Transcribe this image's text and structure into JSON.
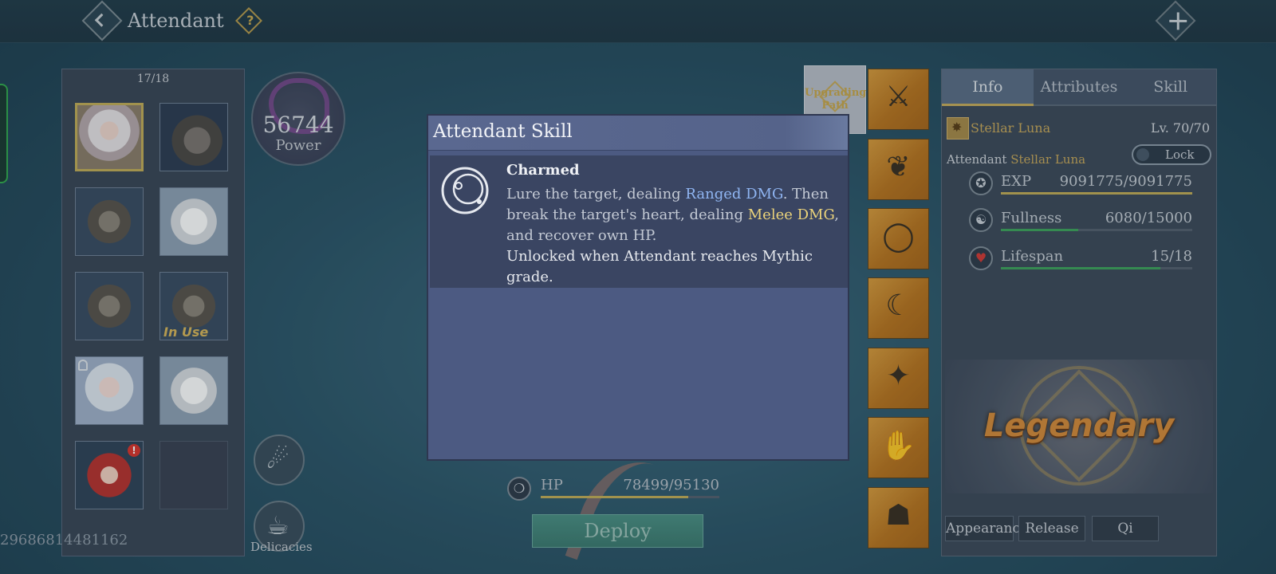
{
  "header": {
    "title": "Attendant",
    "help_glyph": "?",
    "close_glyph": "✕"
  },
  "roster": {
    "count": "17/18",
    "slots": [
      {
        "portrait": "human-white-hair",
        "selected": true
      },
      {
        "portrait": "rhino"
      },
      {
        "portrait": "tabby-cat"
      },
      {
        "portrait": "white-fox"
      },
      {
        "portrait": "tabby-cat"
      },
      {
        "portrait": "tabby-cat",
        "badge": "In Use"
      },
      {
        "portrait": "doll-girl",
        "locked": true
      },
      {
        "portrait": "white-fox"
      },
      {
        "portrait": "red-hair-girl",
        "alert": "!"
      },
      {
        "portrait": "empty"
      }
    ]
  },
  "power": {
    "value": "56744",
    "label": "Power"
  },
  "side_buttons": {
    "delicacies_label": "Delicacies"
  },
  "uid": "29686814481162",
  "upgrade_path": {
    "label_line1": "Upgrading",
    "label_line2": "Path"
  },
  "equipment": [
    {
      "icon": "crossbow-icon",
      "glyph": "⚔"
    },
    {
      "icon": "antler-icon",
      "glyph": "❦"
    },
    {
      "icon": "ring-icon",
      "glyph": "◯"
    },
    {
      "icon": "claw-icon",
      "glyph": "☾"
    },
    {
      "icon": "deer-head-icon",
      "glyph": "✦"
    },
    {
      "icon": "gauntlet-icon",
      "glyph": "✋"
    },
    {
      "icon": "mask-icon",
      "glyph": "☗"
    }
  ],
  "info": {
    "tabs": [
      "Info",
      "Attributes",
      "Skill"
    ],
    "active_tab": "Info",
    "name": "Stellar Luna",
    "level": "Lv. 70/70",
    "attendant_prefix": "Attendant",
    "attendant_name": "Stellar Luna",
    "lock_label": "Lock",
    "stats": [
      {
        "label": "EXP",
        "value": "9091775/9091775",
        "ratio": 1.0,
        "color": "#c3ad57",
        "icon": "exp-icon",
        "glyph": "✪"
      },
      {
        "label": "Fullness",
        "value": "6080/15000",
        "ratio": 0.405,
        "color": "#3fa35c",
        "icon": "fullness-icon",
        "glyph": "☯"
      },
      {
        "label": "Lifespan",
        "value": "15/18",
        "ratio": 0.833,
        "color": "#3fa35c",
        "icon": "lifespan-icon",
        "glyph": "♥"
      }
    ],
    "grade": "Legendary",
    "buttons": {
      "appearance": "Appearance",
      "release": "Release",
      "qi": "Qi"
    }
  },
  "hp": {
    "label": "HP",
    "value": "78499/95130",
    "ratio": 0.825,
    "glyph": "❍"
  },
  "deploy_label": "Deploy",
  "modal": {
    "title": "Attendant Skill",
    "skill_name": "Charmed",
    "desc_1": "Lure the target, dealing ",
    "desc_ranged": "Ranged DMG",
    "desc_2": ". Then break the target's heart, dealing ",
    "desc_melee": "Melee DMG",
    "desc_3": ", and recover own HP.",
    "unlock": "Unlocked when Attendant reaches Mythic grade."
  },
  "colors": {
    "accent_gold": "#c3ad57",
    "ranged_blue": "#8fb5f2",
    "melee_gold": "#ebd37a",
    "bar_green": "#3fa35c"
  }
}
